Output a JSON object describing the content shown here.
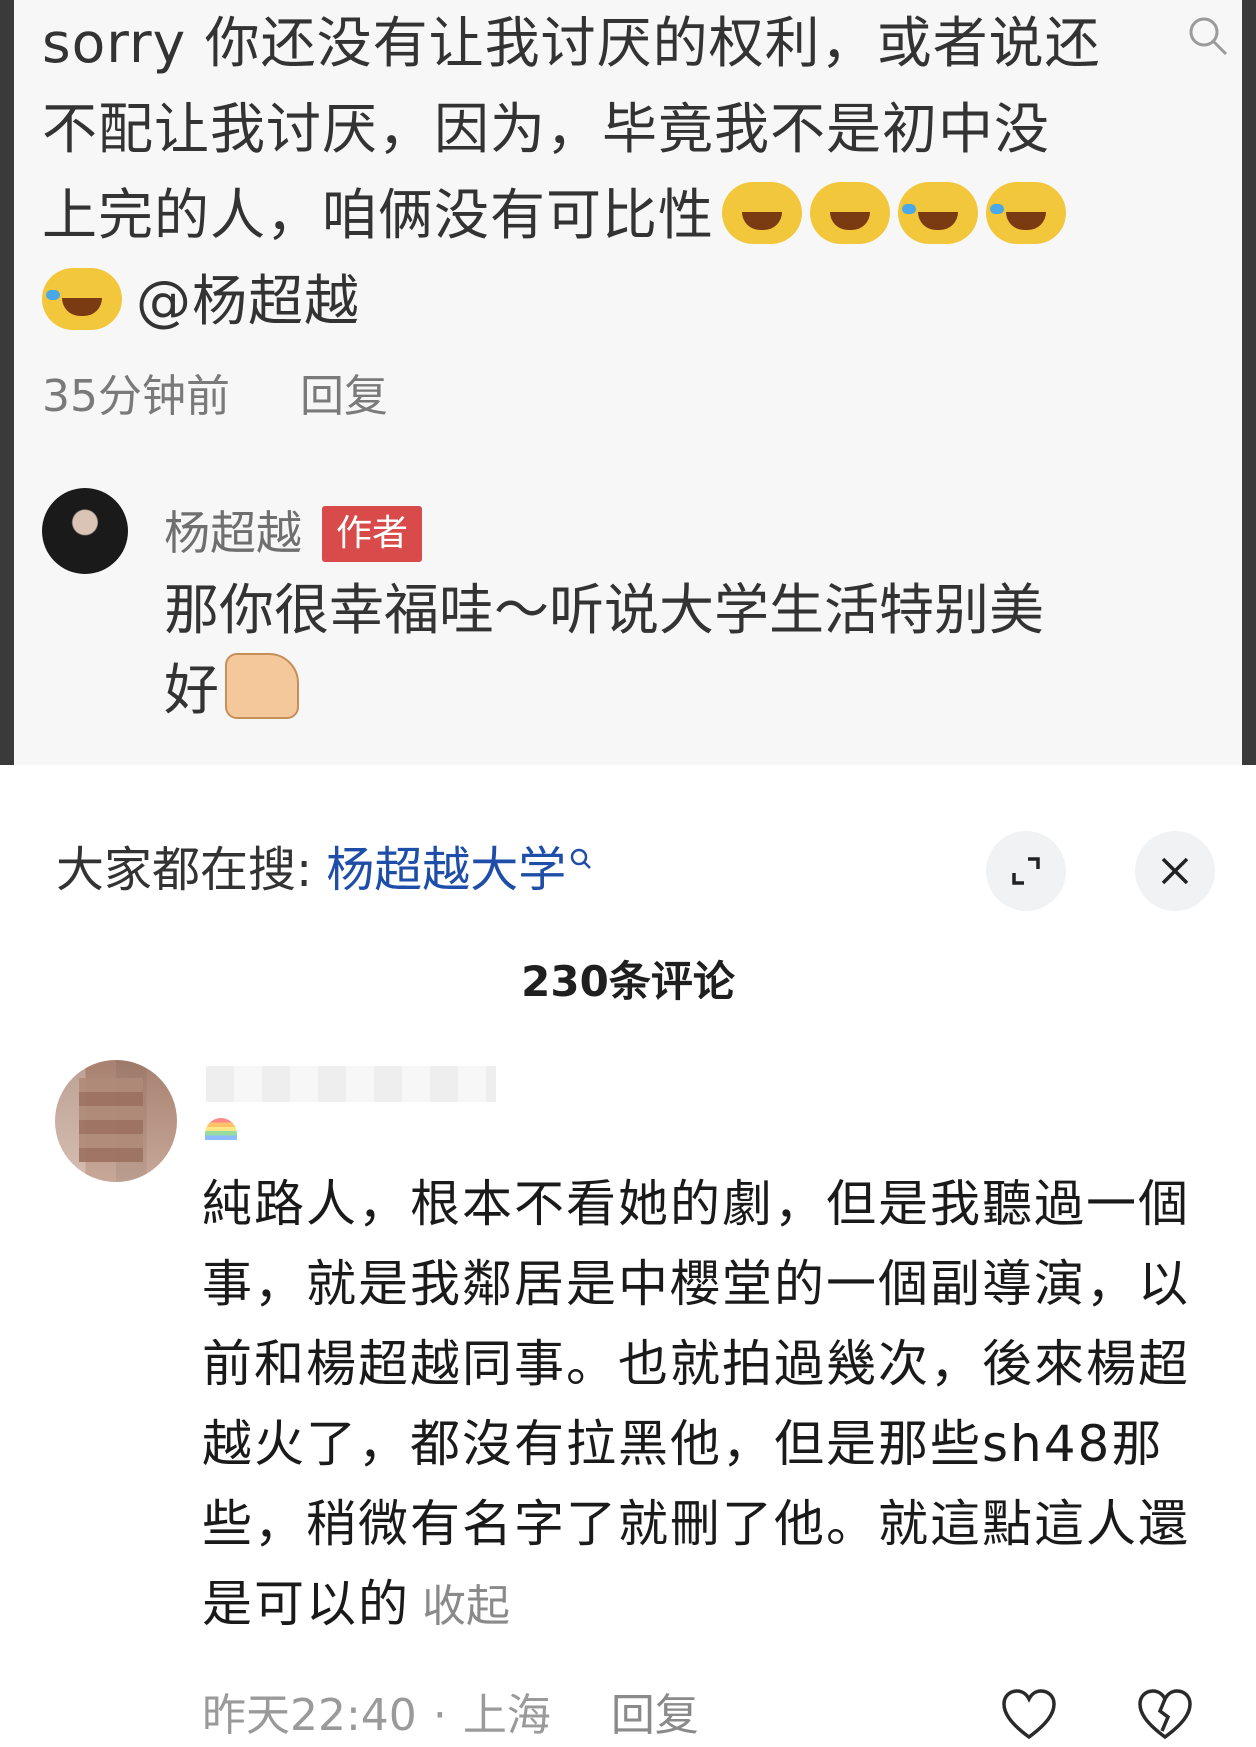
{
  "screenshot": {
    "comment_lines": [
      "sorry 你还没有让我讨厌的权利，或者说还",
      "不配让我讨厌，因为，毕竟我不是初中没",
      "上完的人，咱俩没有可比性"
    ],
    "mention": "@杨超越",
    "time": "35分钟前",
    "reply_label": "回复",
    "author_name": "杨超越",
    "author_tag": "作者",
    "author_reply_line1": "那你很幸福哇～听说大学生活特别美",
    "author_reply_line2": "好"
  },
  "sheet": {
    "search_label": "大家都在搜:",
    "search_term": "杨超越大学",
    "comment_count": "230条评论",
    "comment": {
      "text": "純路人，根本不看她的劇，但是我聽過一個事，就是我鄰居是中櫻堂的一個副導演，以前和楊超越同事。也就拍過幾次，後來楊超越火了，都沒有拉黑他，但是那些sh48那些，稍微有名字了就刪了他。就這點這人還是可以的",
      "collapse_label": "收起",
      "time": "昨天22:40",
      "separator": "·",
      "location": "上海",
      "reply_label": "回复"
    }
  },
  "colors": {
    "search_term": "#1e4ea8",
    "author_tag_bg": "#d94a4a",
    "meta_text": "#9a9a9a"
  }
}
